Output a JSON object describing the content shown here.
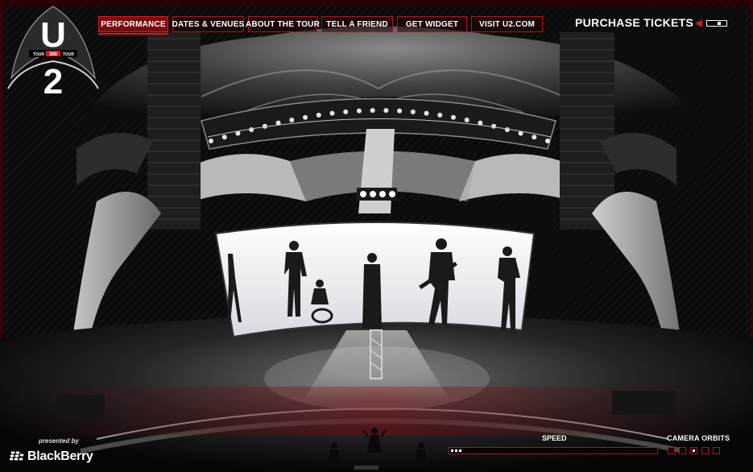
{
  "nav": {
    "items": [
      {
        "label": "PERFORMANCE",
        "active": true
      },
      {
        "label": "DATES & VENUES",
        "active": false
      },
      {
        "label": "ABOUT THE TOUR",
        "active": false
      },
      {
        "label": "TELL A FRIEND",
        "active": false
      },
      {
        "label": "GET WIDGET",
        "active": false
      },
      {
        "label": "VISIT U2.COM",
        "active": false
      }
    ],
    "purchase_label": "PURCHASE TICKETS"
  },
  "logo": {
    "text_top": "U",
    "text_bottom": "2",
    "tour_left": "TOUR",
    "tour_mid": "360",
    "tour_right": "TOUR"
  },
  "controls": {
    "speed_label": "SPEED",
    "speed_level": 0.1,
    "camera_orbits_label": "CAMERA ORBITS",
    "camera_orbit_count": 5,
    "camera_orbit_selected": 3
  },
  "sponsor": {
    "presented_by": "presented by",
    "brand": "BlackBerry"
  },
  "icons": {
    "volume": "speaker-icon",
    "brand": "blackberry-logo-icon"
  },
  "colors": {
    "accent": "#e0141c",
    "border": "#b0121a",
    "background": "#0a0a0a"
  }
}
